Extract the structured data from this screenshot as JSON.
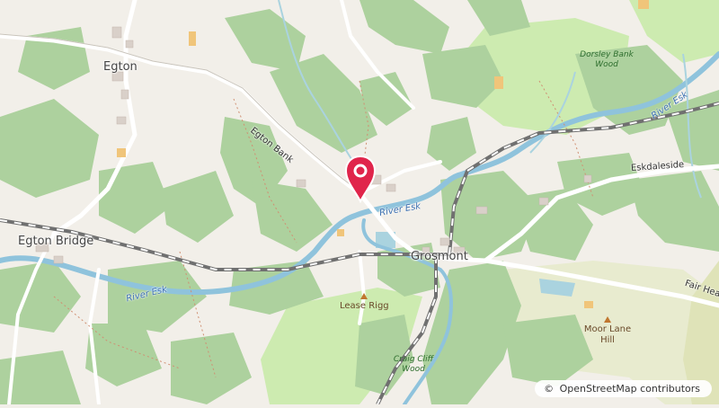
{
  "map": {
    "attribution": {
      "symbol": "©",
      "text": "OpenStreetMap contributors"
    },
    "places": [
      {
        "id": "egton",
        "name": "Egton"
      },
      {
        "id": "egton-bridge",
        "name": "Egton Bridge"
      },
      {
        "id": "grosmont",
        "name": "Grosmont"
      }
    ],
    "roads": [
      {
        "id": "egton-bank",
        "name": "Egton Bank"
      },
      {
        "id": "eskdaleside",
        "name": "Eskdaleside"
      },
      {
        "id": "fair-head",
        "name": "Fair Head"
      }
    ],
    "rivers": [
      {
        "id": "esk-1",
        "name": "River Esk"
      },
      {
        "id": "esk-2",
        "name": "River Esk"
      },
      {
        "id": "esk-3",
        "name": "River Esk"
      }
    ],
    "woods": [
      {
        "id": "dorsley",
        "name": "Dorsley Bank Wood"
      },
      {
        "id": "craig-cliff",
        "name": "Craig Cliff Wood"
      }
    ],
    "peaks": [
      {
        "id": "lease-rigg",
        "name": "Lease Rigg"
      },
      {
        "id": "moor-lane",
        "name": "Moor Lane Hill"
      }
    ],
    "colors": {
      "background": "#f2efe9",
      "forest": "#add19e",
      "meadow": "#cdebb0",
      "heath": "#e8ebcf",
      "water": "#aad3df",
      "river": "#8fc3dc",
      "road": "#ffffff",
      "rail": "#707070",
      "marker": "#e0254b"
    },
    "marker": {
      "icon": "map-pin-icon"
    }
  }
}
